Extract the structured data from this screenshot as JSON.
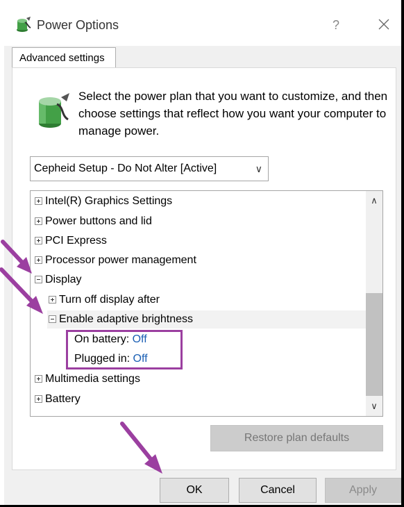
{
  "window": {
    "title": "Power Options",
    "help_glyph": "?",
    "close_glyph": "✕"
  },
  "tab": {
    "label": "Advanced settings"
  },
  "description": "Select the power plan that you want to customize, and then choose settings that reflect how you want your computer to manage power.",
  "plan_select": {
    "value": "Cepheid Setup - Do Not Alter [Active]",
    "chevron": "∨"
  },
  "tree": {
    "items": [
      {
        "label": "Intel(R) Graphics Settings",
        "expander": "plus"
      },
      {
        "label": "Power buttons and lid",
        "expander": "plus"
      },
      {
        "label": "PCI Express",
        "expander": "plus"
      },
      {
        "label": "Processor power management",
        "expander": "plus"
      },
      {
        "label": "Display",
        "expander": "minus"
      },
      {
        "label": "Turn off display after",
        "expander": "plus"
      },
      {
        "label": "Enable adaptive brightness",
        "expander": "minus"
      },
      {
        "label": "On battery:",
        "value": "Off"
      },
      {
        "label": "Plugged in:",
        "value": "Off"
      },
      {
        "label": "Multimedia settings",
        "expander": "plus"
      },
      {
        "label": "Battery",
        "expander": "plus"
      }
    ]
  },
  "scroll": {
    "up": "∧",
    "down": "∨"
  },
  "buttons": {
    "restore": "Restore plan defaults",
    "ok": "OK",
    "cancel": "Cancel",
    "apply": "Apply"
  },
  "colors": {
    "annotation": "#9b3fa0",
    "value_link": "#1a5fb4"
  }
}
